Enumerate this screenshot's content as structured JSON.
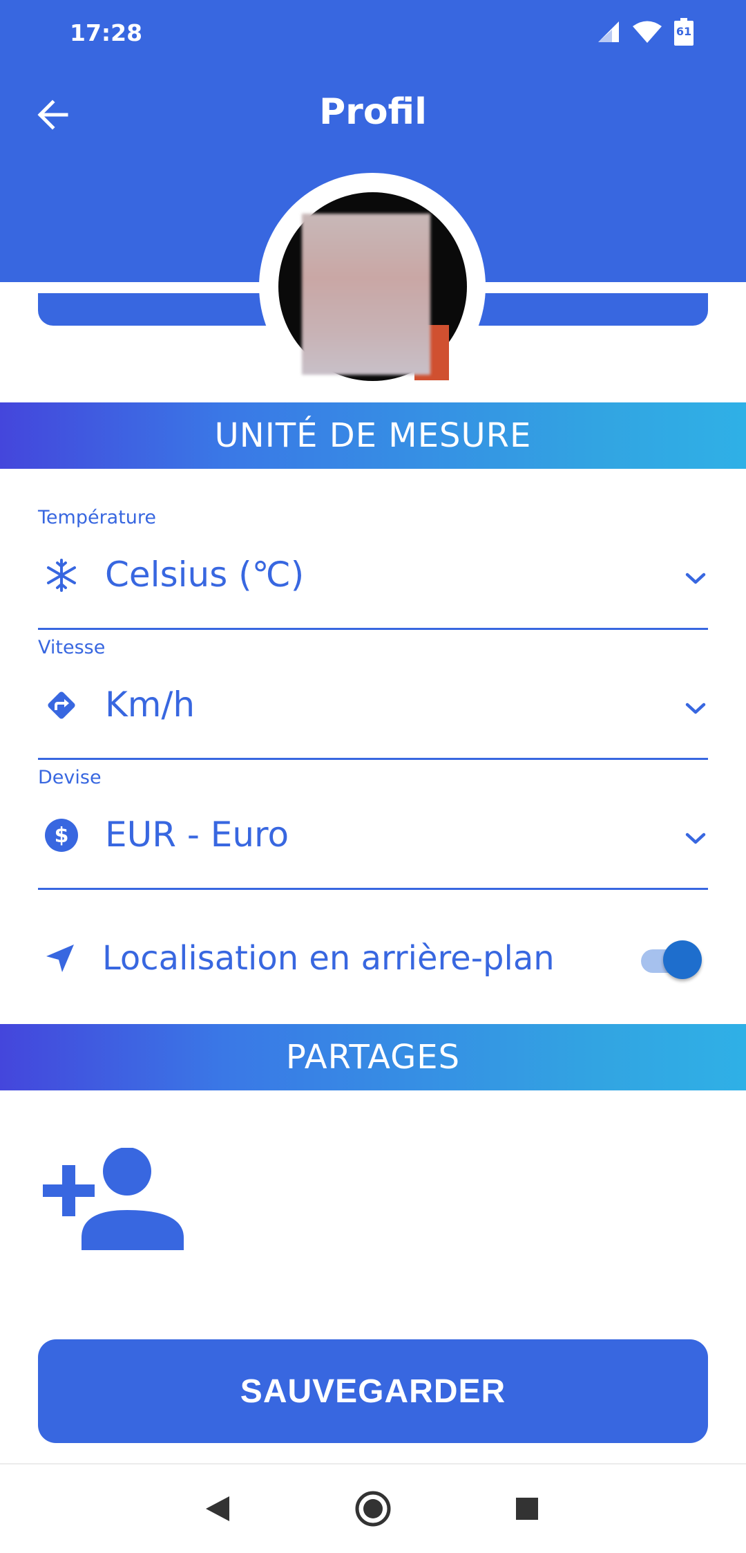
{
  "status_bar": {
    "time": "17:28",
    "battery": "61"
  },
  "header": {
    "title": "Profil"
  },
  "sections": {
    "units_title": "UNITÉ DE MESURE",
    "shares_title": "PARTAGES"
  },
  "fields": [
    {
      "label": "Température",
      "value": "Celsius (℃)",
      "icon": "snowflake-icon"
    },
    {
      "label": "Vitesse",
      "value": "Km/h",
      "icon": "directions-icon"
    },
    {
      "label": "Devise",
      "value": "EUR - Euro",
      "icon": "dollar-icon"
    }
  ],
  "location": {
    "label": "Localisation en arrière-plan",
    "enabled": true
  },
  "actions": {
    "save_label": "SAUVEGARDER"
  },
  "colors": {
    "primary": "#3867e0",
    "white": "#ffffff",
    "toggle_on": "#1e6ecd"
  }
}
